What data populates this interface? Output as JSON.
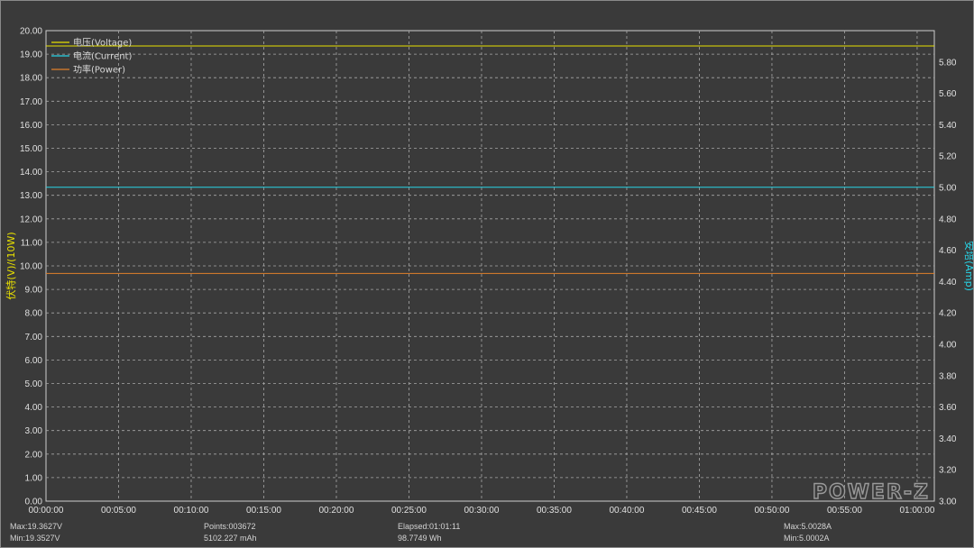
{
  "chart_data": {
    "type": "line",
    "ylabel_left": "伏特(V)/(10W)",
    "ylabel_right": "安培(Amp)",
    "ylim_left": [
      0,
      20
    ],
    "ylim_right": [
      3.0,
      6.0
    ],
    "xlim_seconds": [
      0,
      3671
    ],
    "left_ticks": [
      "0.00",
      "1.00",
      "2.00",
      "3.00",
      "4.00",
      "5.00",
      "6.00",
      "7.00",
      "8.00",
      "9.00",
      "10.00",
      "11.00",
      "12.00",
      "13.00",
      "14.00",
      "15.00",
      "16.00",
      "17.00",
      "18.00",
      "19.00",
      "20.00"
    ],
    "right_ticks": [
      "3.00",
      "3.20",
      "3.40",
      "3.60",
      "3.80",
      "4.00",
      "4.20",
      "4.40",
      "4.60",
      "4.80",
      "5.00",
      "5.20",
      "5.40",
      "5.60",
      "5.80"
    ],
    "x_ticks": [
      "00:00:00",
      "00:05:00",
      "00:10:00",
      "00:15:00",
      "00:20:00",
      "00:25:00",
      "00:30:00",
      "00:35:00",
      "00:40:00",
      "00:45:00",
      "00:50:00",
      "00:55:00",
      "01:00:00"
    ],
    "series": [
      {
        "name": "电压(Voltage)",
        "axis": "left",
        "color": "#e8e000",
        "points": [
          [
            0,
            19.35
          ],
          [
            3671,
            19.35
          ]
        ]
      },
      {
        "name": "电流(Current)",
        "axis": "right",
        "color": "#27d4e6",
        "points": [
          [
            0,
            5.001
          ],
          [
            2640,
            5.001
          ],
          [
            3000,
            5.002
          ],
          [
            3671,
            5.001
          ]
        ]
      },
      {
        "name": "功率(Power)",
        "axis": "left",
        "color": "#e0802a",
        "points": [
          [
            0,
            9.68
          ],
          [
            3671,
            9.68
          ]
        ]
      }
    ],
    "legend_position": "top-left",
    "grid": true
  },
  "logo_text": "POWER-Z",
  "stats": {
    "max_v": "Max:19.3627V",
    "min_v": "Min:19.3527V",
    "points": "Points:003672",
    "mah": "5102.227 mAh",
    "elapsed": "Elapsed:01:01:11",
    "wh": "98.7749 Wh",
    "max_a": "Max:5.0028A",
    "min_a": "Min:5.0002A"
  }
}
